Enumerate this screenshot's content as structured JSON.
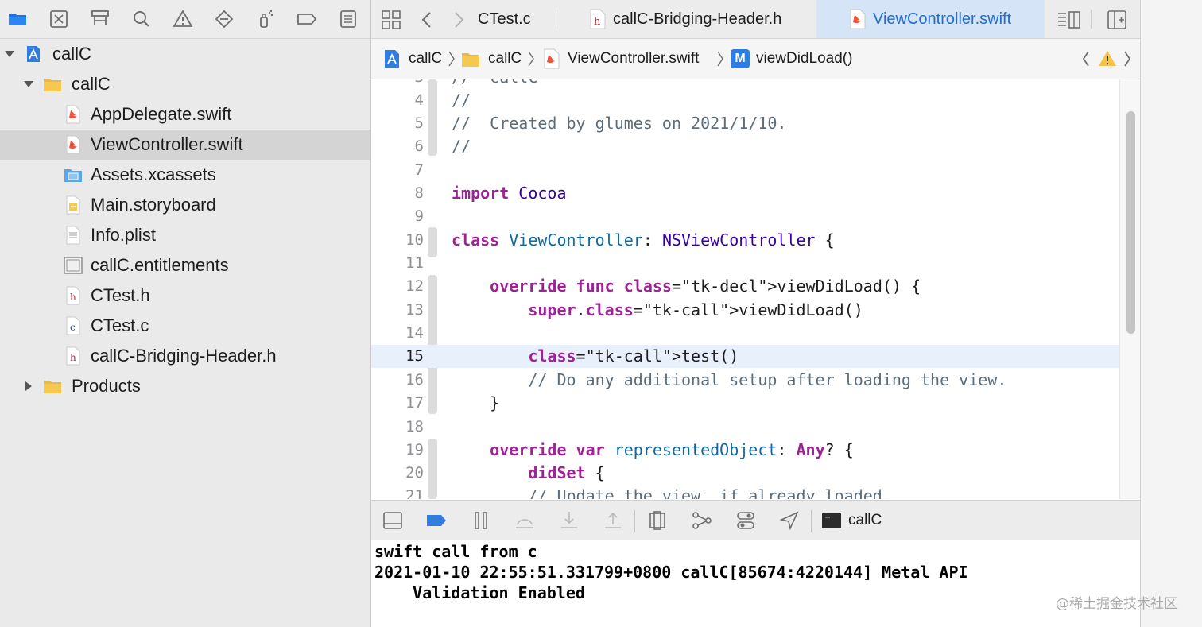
{
  "navigator": {
    "toolbar_icons": [
      "folder-icon",
      "source-control-icon",
      "hierarchy-icon",
      "search-icon",
      "warning-icon",
      "test-diamond-icon",
      "debug-spray-icon",
      "breakpoint-tag-icon",
      "report-list-icon"
    ],
    "tree": [
      {
        "label": "callC",
        "kind": "project",
        "depth": 0,
        "disclosure": "open"
      },
      {
        "label": "callC",
        "kind": "folder",
        "depth": 1,
        "disclosure": "open"
      },
      {
        "label": "AppDelegate.swift",
        "kind": "swift",
        "depth": 2
      },
      {
        "label": "ViewController.swift",
        "kind": "swift",
        "depth": 2,
        "selected": true
      },
      {
        "label": "Assets.xcassets",
        "kind": "assets",
        "depth": 2
      },
      {
        "label": "Main.storyboard",
        "kind": "storyboard",
        "depth": 2
      },
      {
        "label": "Info.plist",
        "kind": "plist",
        "depth": 2
      },
      {
        "label": "callC.entitlements",
        "kind": "entitlements",
        "depth": 2
      },
      {
        "label": "CTest.h",
        "kind": "h",
        "depth": 2
      },
      {
        "label": "CTest.c",
        "kind": "c",
        "depth": 2
      },
      {
        "label": "callC-Bridging-Header.h",
        "kind": "h",
        "depth": 2
      },
      {
        "label": "Products",
        "kind": "folder",
        "depth": 1,
        "disclosure": "closed"
      }
    ]
  },
  "tabs": [
    {
      "label": "CTest.c",
      "active": false
    },
    {
      "label": "callC-Bridging-Header.h",
      "active": false
    },
    {
      "label": "ViewController.swift",
      "active": true
    }
  ],
  "jump_bar": {
    "crumbs": [
      "callC",
      "callC",
      "ViewController.swift",
      "viewDidLoad()"
    ],
    "method_badge": "M"
  },
  "editor": {
    "current_line": "15",
    "lines": [
      {
        "n": "3",
        "t": "//  callC"
      },
      {
        "n": "4",
        "t": "//"
      },
      {
        "n": "5",
        "t": "//  Created by glumes on 2021/1/10."
      },
      {
        "n": "6",
        "t": "//"
      },
      {
        "n": "7",
        "t": ""
      },
      {
        "n": "8",
        "t": "import Cocoa"
      },
      {
        "n": "9",
        "t": ""
      },
      {
        "n": "10",
        "t": "class ViewController: NSViewController {"
      },
      {
        "n": "11",
        "t": ""
      },
      {
        "n": "12",
        "t": "    override func viewDidLoad() {"
      },
      {
        "n": "13",
        "t": "        super.viewDidLoad()"
      },
      {
        "n": "14",
        "t": ""
      },
      {
        "n": "15",
        "t": "        test()"
      },
      {
        "n": "16",
        "t": "        // Do any additional setup after loading the view."
      },
      {
        "n": "17",
        "t": "    }"
      },
      {
        "n": "18",
        "t": ""
      },
      {
        "n": "19",
        "t": "    override var representedObject: Any? {"
      },
      {
        "n": "20",
        "t": "        didSet {"
      },
      {
        "n": "21",
        "t": "        // Update the view, if already loaded."
      }
    ]
  },
  "debug_bar": {
    "target_label": "callC"
  },
  "console": {
    "lines": [
      "swift call from c",
      "2021-01-10 22:55:51.331799+0800 callC[85674:4220144] Metal API",
      "    Validation Enabled"
    ]
  },
  "watermark": "@稀土掘金技术社区",
  "colors": {
    "accent": "#1c6ed6",
    "keyword": "#9b2393",
    "comment": "#5d6c79",
    "type": "#3900a0",
    "declaration": "#0f68a0",
    "selection": "#d4d4d4",
    "current_line": "#e8f1fb"
  }
}
